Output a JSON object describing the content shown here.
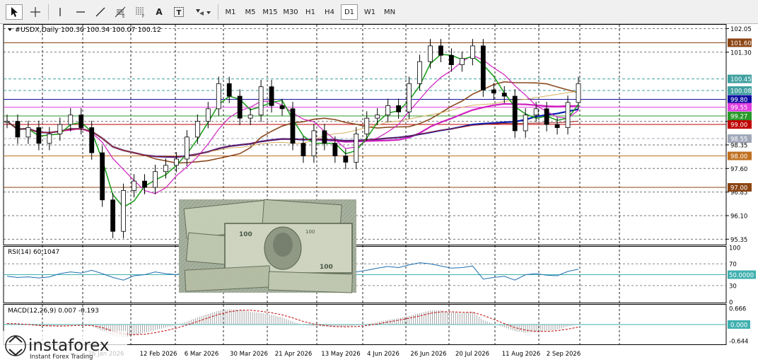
{
  "toolbar": {
    "tools": [
      {
        "name": "cursor-icon",
        "label": ""
      },
      {
        "name": "crosshair-icon",
        "label": ""
      },
      {
        "name": "vertical-line-icon",
        "label": ""
      },
      {
        "name": "horizontal-line-icon",
        "label": ""
      },
      {
        "name": "trendline-icon",
        "label": ""
      },
      {
        "name": "fibonacci-icon",
        "label": ""
      },
      {
        "name": "fibo-grid-icon",
        "label": ""
      },
      {
        "name": "text-tool",
        "label": "A"
      },
      {
        "name": "text-label-tool",
        "label": "T"
      },
      {
        "name": "shapes-dropdown-icon",
        "label": ""
      }
    ],
    "timeframes": [
      "M1",
      "M5",
      "M15",
      "M30",
      "H1",
      "H4",
      "D1",
      "W1",
      "MN"
    ],
    "active_timeframe": "D1"
  },
  "header": {
    "symbol_line": "#USDX,Daily  100.30 100.34 100.07 100.12"
  },
  "watermark": {
    "brand": "instaforex",
    "tagline": "Instant Forex Trading"
  },
  "colors": {
    "grid": "#000000",
    "level_brown": "#8b4513",
    "level_blue": "#1010a0",
    "level_magenta": "#e040e0",
    "level_green": "#2a9a2a",
    "level_red": "#c00000",
    "level_gray": "#a0a8b8",
    "level_teal": "#40a0a0",
    "level_orange": "#c07020",
    "ma_blue": "#0a1ab0",
    "ma_magenta": "#d020c0",
    "ma_brown": "#8b4a20",
    "ma_tan": "#d4b060",
    "ma_green": "#20a020",
    "ma_red": "#a02020",
    "rsi_line": "#1f6fb0",
    "macd_hist": "#a8a8a8",
    "macd_signal": "#c00000"
  },
  "chart_data": [
    {
      "type": "candlestick",
      "title": "#USDX,Daily",
      "ohlc_current": {
        "open": 100.3,
        "high": 100.34,
        "low": 100.07,
        "close": 100.12
      },
      "x_tick_labels": [
        "26 Jan 2026",
        "12 Feb 2026",
        "6 Mar 2026",
        "30 Mar 2026",
        "21 Apr 2026",
        "13 May 2026",
        "4 Jun 2026",
        "26 Jun 2026",
        "20 Jul 2026",
        "11 Aug 2026",
        "2 Sep 2026"
      ],
      "y_tick_labels": [
        "102.05",
        "101.30",
        "99.10",
        "98.35",
        "97.60",
        "96.85",
        "96.10",
        "95.35"
      ],
      "ylim": [
        95.2,
        102.15
      ],
      "price_levels": [
        {
          "label": "101.60",
          "value": 101.6,
          "color": "level_brown"
        },
        {
          "label": "100.45",
          "value": 100.45,
          "color": "level_teal"
        },
        {
          "label": "100.08",
          "value": 100.08,
          "color": "level_teal"
        },
        {
          "label": "99.80",
          "value": 99.8,
          "color": "level_blue"
        },
        {
          "label": "99.55",
          "value": 99.55,
          "color": "level_magenta"
        },
        {
          "label": "99.27",
          "value": 99.27,
          "color": "level_green"
        },
        {
          "label": "99.00",
          "value": 99.0,
          "color": "level_red"
        },
        {
          "label": "98.55",
          "value": 98.55,
          "color": "level_gray"
        },
        {
          "label": "98.00",
          "value": 98.0,
          "color": "level_orange"
        },
        {
          "label": "97.00",
          "value": 97.0,
          "color": "level_brown"
        }
      ],
      "price_points": [
        99.1,
        98.6,
        98.9,
        98.4,
        98.7,
        99.0,
        99.3,
        98.9,
        98.1,
        96.6,
        95.6,
        96.9,
        97.2,
        97.0,
        97.5,
        97.7,
        97.9,
        98.6,
        99.1,
        99.5,
        100.3,
        99.9,
        99.2,
        99.3,
        100.2,
        99.6,
        99.5,
        98.4,
        98.0,
        98.8,
        98.4,
        98.0,
        97.8,
        98.7,
        99.2,
        99.3,
        99.6,
        99.4,
        100.3,
        101.0,
        101.5,
        101.2,
        100.9,
        101.1,
        101.5,
        100.1,
        100.0,
        99.9,
        98.8,
        99.3,
        99.5,
        99.0,
        98.9,
        99.7,
        100.3
      ]
    },
    {
      "type": "line",
      "title": "RSI(14) 60.1047",
      "y_tick_labels": [
        "100",
        "70",
        "50",
        "30",
        "0"
      ],
      "ylim": [
        0,
        100
      ],
      "levels": [
        {
          "label": "50.0000",
          "value": 50
        }
      ],
      "values": [
        47,
        45,
        46,
        44,
        46,
        52,
        55,
        53,
        58,
        52,
        45,
        40,
        48,
        50,
        55,
        52,
        50,
        55,
        60,
        58,
        64,
        60,
        57,
        55,
        58,
        52,
        48,
        45,
        47,
        51,
        48,
        46,
        49,
        55,
        58,
        62,
        65,
        63,
        68,
        72,
        70,
        66,
        62,
        63,
        66,
        42,
        45,
        47,
        40,
        50,
        52,
        49,
        48,
        56,
        60
      ]
    },
    {
      "type": "bar",
      "title": "MACD(12,26,9) 0.007 -0.193",
      "y_tick_labels": [
        "0.666",
        "0.000",
        "-0.644"
      ],
      "ylim": [
        -0.75,
        0.75
      ],
      "levels": [
        {
          "label": "0.000",
          "value": 0
        }
      ],
      "histogram": [
        0.05,
        0.02,
        -0.02,
        -0.06,
        -0.08,
        -0.06,
        -0.03,
        0.0,
        -0.05,
        -0.25,
        -0.45,
        -0.5,
        -0.42,
        -0.32,
        -0.22,
        -0.12,
        -0.02,
        0.12,
        0.28,
        0.42,
        0.55,
        0.6,
        0.58,
        0.5,
        0.46,
        0.38,
        0.28,
        0.12,
        -0.02,
        -0.06,
        -0.08,
        -0.1,
        -0.09,
        -0.04,
        0.02,
        0.1,
        0.18,
        0.25,
        0.34,
        0.45,
        0.55,
        0.56,
        0.48,
        0.45,
        0.5,
        0.18,
        0.02,
        -0.12,
        -0.26,
        -0.32,
        -0.3,
        -0.24,
        -0.2,
        -0.08,
        0.01
      ],
      "signal": [
        0.04,
        0.03,
        0.0,
        -0.03,
        -0.05,
        -0.06,
        -0.05,
        -0.03,
        -0.04,
        -0.12,
        -0.26,
        -0.36,
        -0.4,
        -0.38,
        -0.32,
        -0.24,
        -0.14,
        -0.02,
        0.12,
        0.26,
        0.4,
        0.5,
        0.56,
        0.56,
        0.52,
        0.46,
        0.38,
        0.26,
        0.12,
        0.02,
        -0.04,
        -0.08,
        -0.09,
        -0.08,
        -0.04,
        0.02,
        0.1,
        0.17,
        0.25,
        0.34,
        0.44,
        0.5,
        0.5,
        0.48,
        0.48,
        0.36,
        0.2,
        0.04,
        -0.12,
        -0.22,
        -0.27,
        -0.27,
        -0.24,
        -0.18,
        -0.1
      ]
    }
  ]
}
